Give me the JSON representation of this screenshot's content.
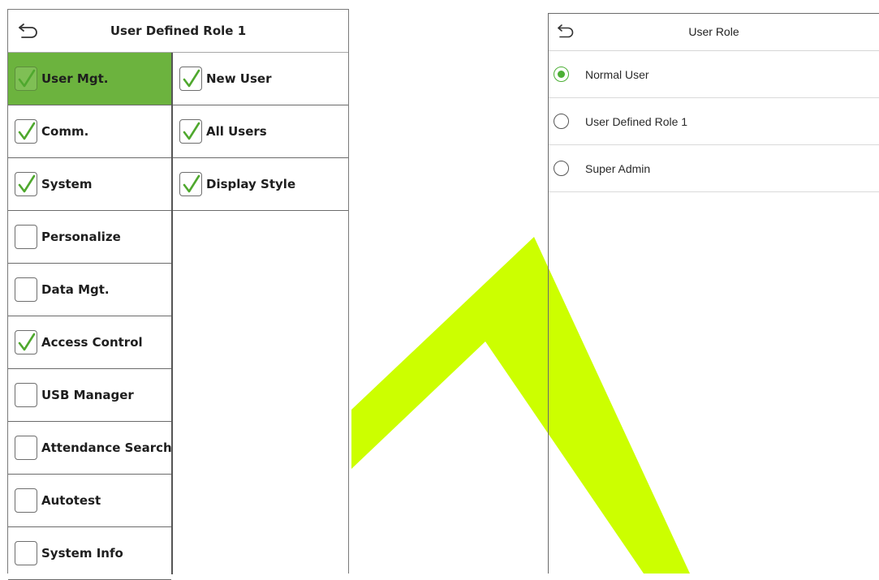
{
  "watermark": {
    "color": "#ccff00"
  },
  "left_panel": {
    "title": "User Defined Role 1",
    "back_icon": "back-arrow-icon",
    "accent": "#6cb33e",
    "menu": [
      {
        "label": "User Mgt.",
        "checked": true,
        "selected": true
      },
      {
        "label": "Comm.",
        "checked": true,
        "selected": false
      },
      {
        "label": "System",
        "checked": true,
        "selected": false
      },
      {
        "label": "Personalize",
        "checked": false,
        "selected": false
      },
      {
        "label": "Data Mgt.",
        "checked": false,
        "selected": false
      },
      {
        "label": "Access Control",
        "checked": true,
        "selected": false
      },
      {
        "label": "USB Manager",
        "checked": false,
        "selected": false
      },
      {
        "label": "Attendance Search",
        "checked": false,
        "selected": false
      },
      {
        "label": "Autotest",
        "checked": false,
        "selected": false
      },
      {
        "label": "System Info",
        "checked": false,
        "selected": false
      }
    ],
    "permissions": [
      {
        "label": "New User",
        "checked": true
      },
      {
        "label": "All Users",
        "checked": true
      },
      {
        "label": "Display Style",
        "checked": true
      }
    ]
  },
  "right_panel": {
    "title": "User Role",
    "back_icon": "back-arrow-icon",
    "roles": [
      {
        "label": "Normal User",
        "selected": true
      },
      {
        "label": "User Defined Role 1",
        "selected": false
      },
      {
        "label": "Super Admin",
        "selected": false
      }
    ]
  }
}
